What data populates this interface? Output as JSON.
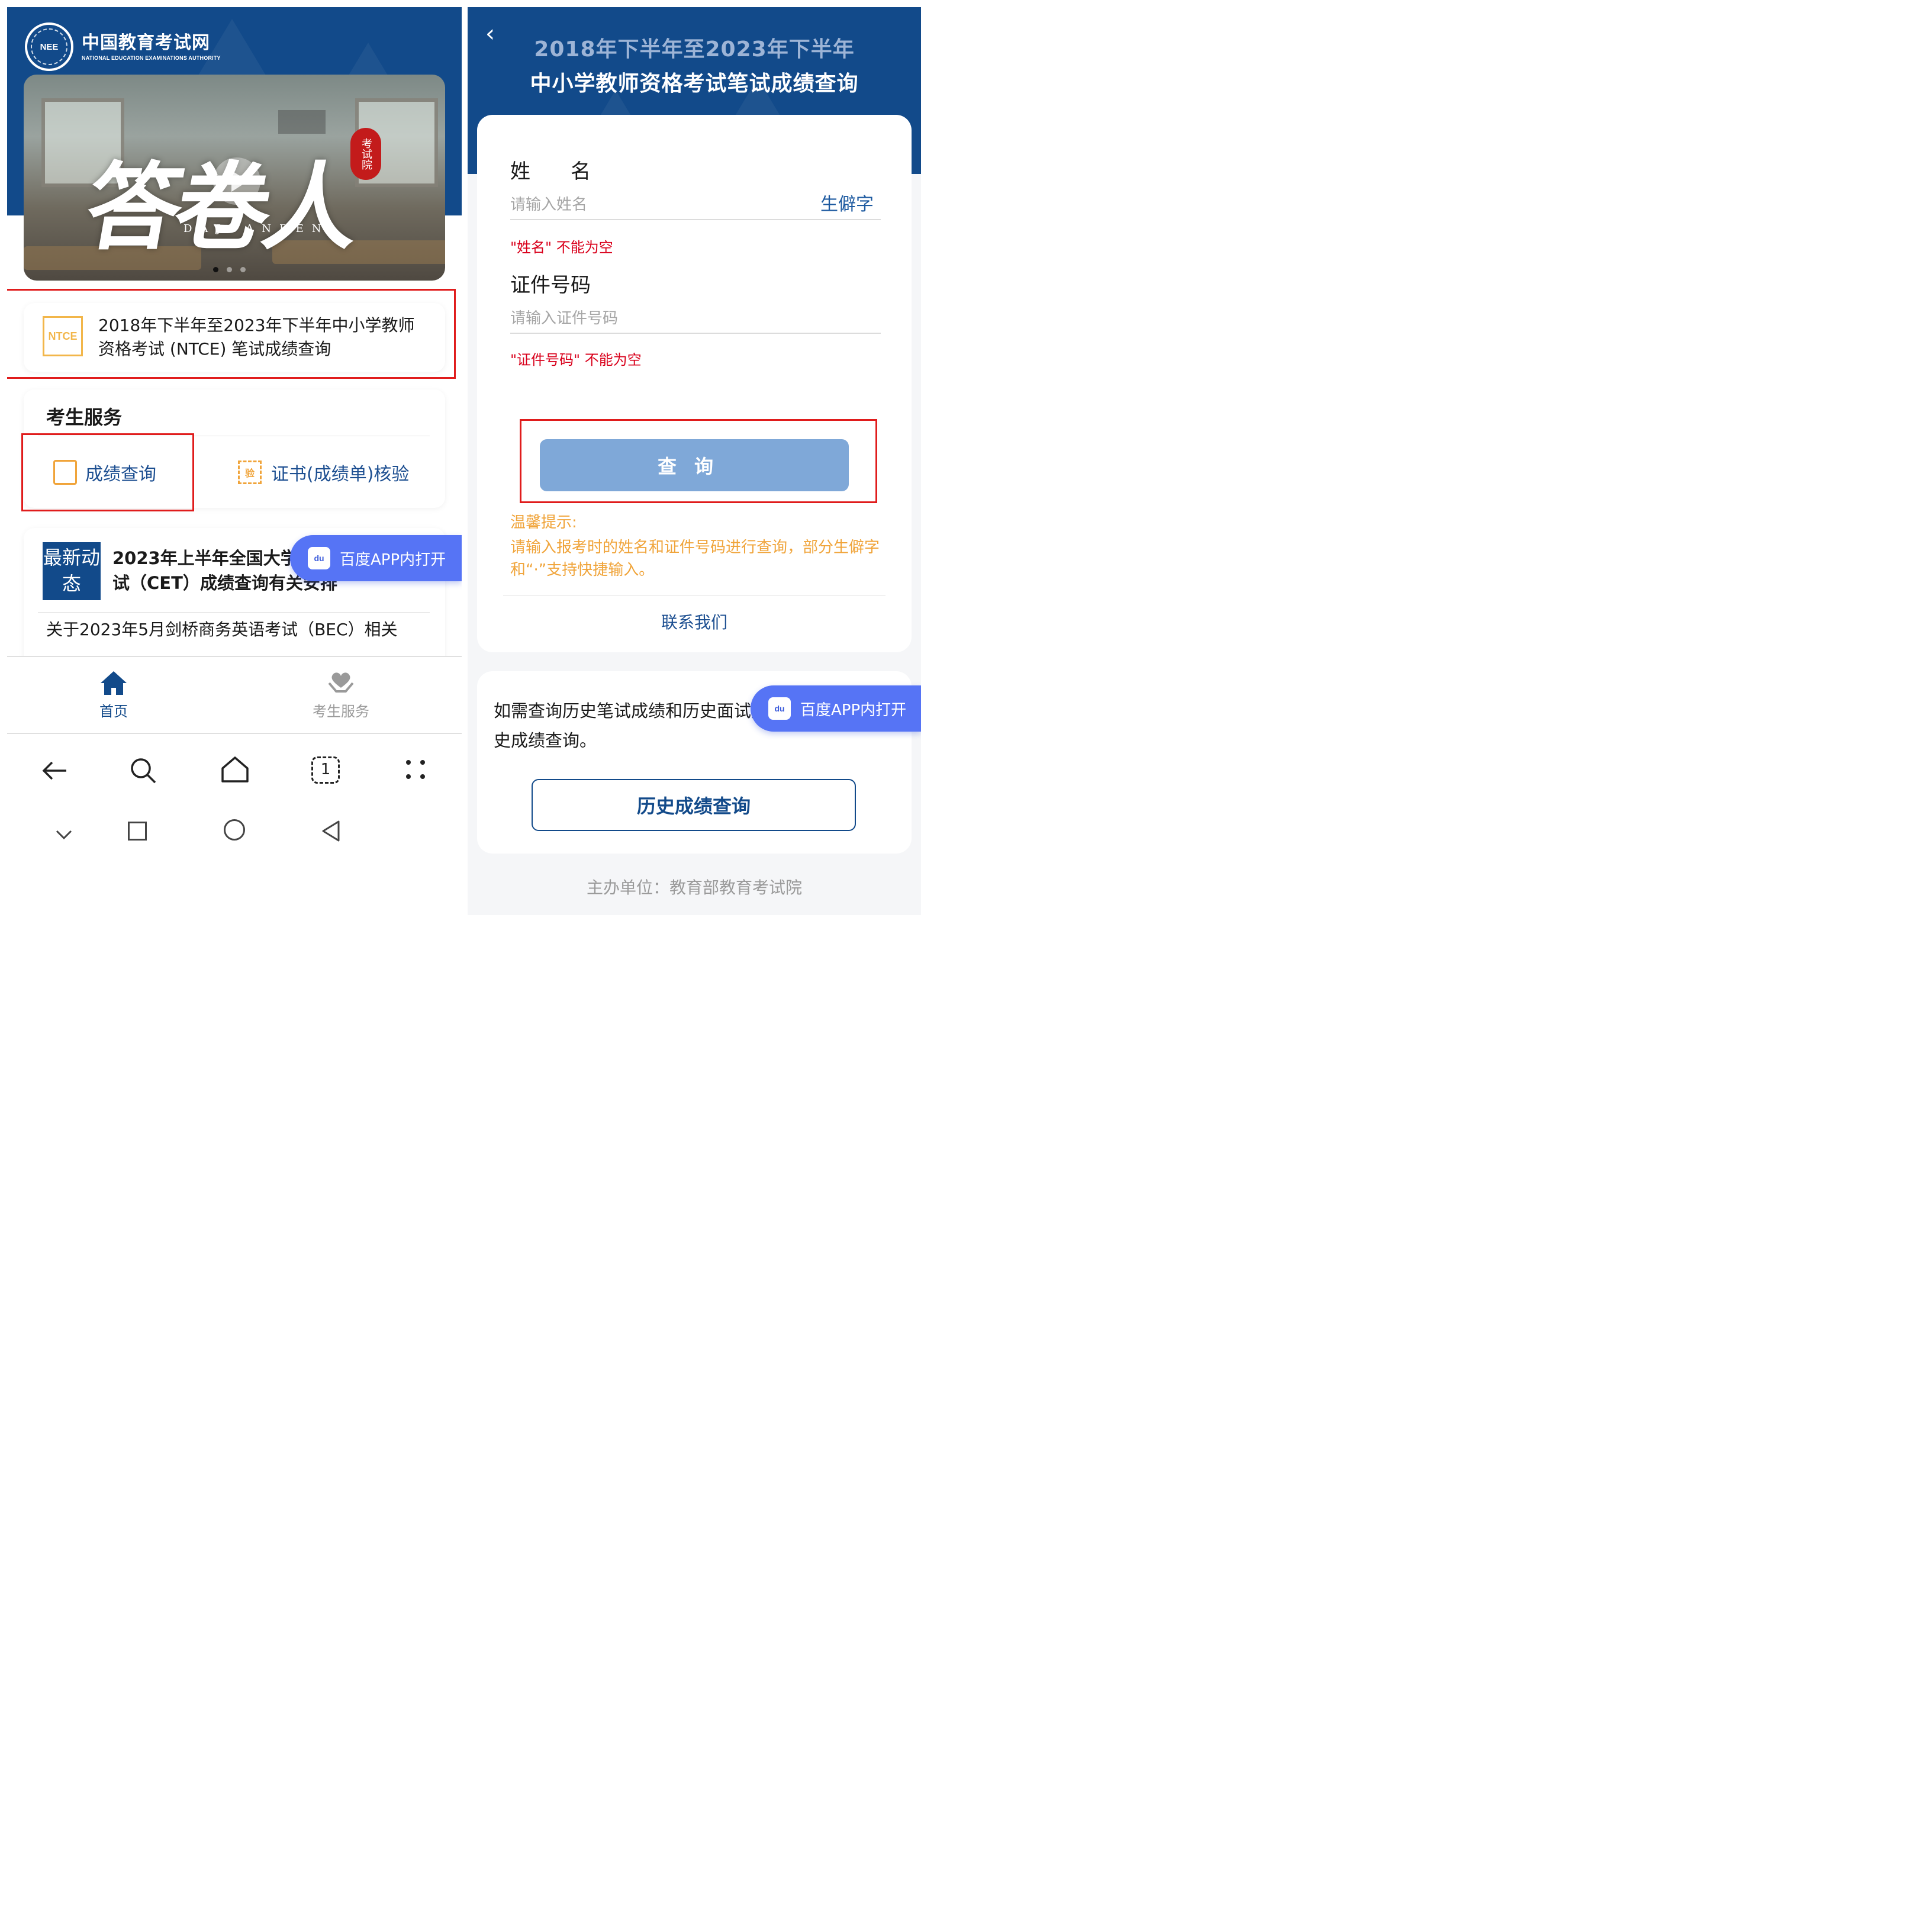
{
  "left": {
    "logo": {
      "cn": "中国教育考试网",
      "en": "NATIONAL EDUCATION EXAMINATIONS AUTHORITY",
      "badge": "NEE"
    },
    "banner": {
      "title": "答卷人",
      "subtitle": "DAJUANREN",
      "seal": "考试院"
    },
    "ntce": {
      "badge": "NTCE",
      "text": "2018年下半年至2023年下半年中小学教师资格考试 (NTCE) 笔试成绩查询"
    },
    "services": {
      "title": "考生服务",
      "items": [
        {
          "label": "成绩查询",
          "icon": "score-search-icon"
        },
        {
          "label": "证书(成绩单)核验",
          "icon": "certificate-verify-icon",
          "icon_text": "验"
        }
      ]
    },
    "news": {
      "badge": "最新动态",
      "title": "2023年上半年全国大学英语四、六级考试（CET）成绩查询有关安排",
      "item": "关于2023年5月剑桥商务英语考试（BEC）相关"
    },
    "baidu_button": "百度APP内打开",
    "tabbar": [
      {
        "label": "首页",
        "icon": "home-icon",
        "active": true
      },
      {
        "label": "考生服务",
        "icon": "heart-service-icon",
        "active": false
      }
    ],
    "browser_bar": [
      "back-arrow-icon",
      "search-icon",
      "home-outline-icon",
      "tabs-icon",
      "more-icon"
    ],
    "browser_tab_count": "1",
    "nav_bar": [
      "collapse-icon",
      "recent-apps-icon",
      "home-circle-icon",
      "back-triangle-icon"
    ]
  },
  "right": {
    "header": {
      "title_line1": "2018年下半年至2023年下半年",
      "title_line2": "中小学教师资格考试笔试成绩查询"
    },
    "form": {
      "name_label": "姓　　名",
      "name_placeholder": "请输入姓名",
      "rare_char": "生僻字",
      "name_error": "\"姓名\" 不能为空",
      "id_label": "证件号码",
      "id_placeholder": "请输入证件号码",
      "id_error": "\"证件号码\" 不能为空",
      "query_button": "查询",
      "tip_title": "温馨提示:",
      "tip_text": "请输入报考时的姓名和证件号码进行查询，部分生僻字和“·”支持快捷输入。",
      "contact": "联系我们"
    },
    "history": {
      "text": "如需查询历史笔试成绩和历史面试成绩，请点击历史成绩查询。",
      "button": "历史成绩查询"
    },
    "baidu_button": "百度APP内打开",
    "organizer": "主办单位：教育部教育考试院"
  },
  "colors": {
    "brand_blue": "#124a8a",
    "accent_orange": "#f0a43a",
    "error_red": "#d9001b",
    "highlight_red": "#e01c1c",
    "baidu_blue": "#5674f5"
  }
}
